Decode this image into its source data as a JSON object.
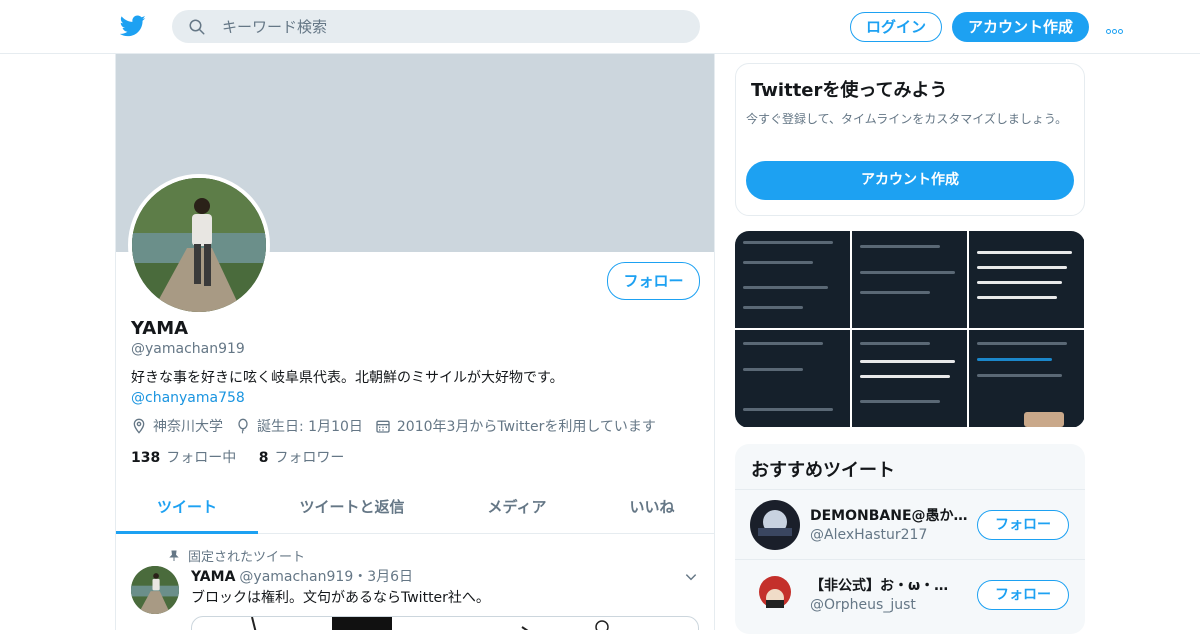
{
  "header": {
    "search_placeholder": "キーワード検索",
    "login_label": "ログイン",
    "signup_label": "アカウント作成"
  },
  "profile": {
    "follow_label": "フォロー",
    "name": "YAMA",
    "handle": "@yamachan919",
    "bio": "好きな事を好きに呟く岐阜県代表。北朝鮮のミサイルが大好物です。",
    "bio_link": "@chanyama758",
    "location": "神奈川大学",
    "birthday": "誕生日: 1月10日",
    "joined": "2010年3月からTwitterを利用しています",
    "following_count": "138",
    "following_label": "フォロー中",
    "followers_count": "8",
    "followers_label": "フォロワー"
  },
  "tabs": [
    {
      "label": "ツイート"
    },
    {
      "label": "ツイートと返信"
    },
    {
      "label": "メディア"
    },
    {
      "label": "いいね"
    }
  ],
  "pinned_tweet": {
    "pinned_label": "固定されたツイート",
    "name": "YAMA",
    "handle_date": "@yamachan919・3月6日",
    "text": "ブロックは権利。文句があるならTwitter社へ。"
  },
  "signup_card": {
    "title": "Twitterを使ってみよう",
    "description": "今すぐ登録して、タイムラインをカスタマイズしましょう。",
    "button_label": "アカウント作成"
  },
  "recommendations": {
    "title": "おすすめツイート",
    "items": [
      {
        "name": "DEMONBANE@愚か…",
        "handle": "@AlexHastur217",
        "button_label": "フォロー"
      },
      {
        "name": "【非公式】お・ω・…",
        "handle": "@Orpheus_just",
        "button_label": "フォロー"
      }
    ]
  },
  "colors": {
    "accent": "#1da1f2",
    "banner": "#ccd6dd",
    "muted_text": "#657786"
  }
}
